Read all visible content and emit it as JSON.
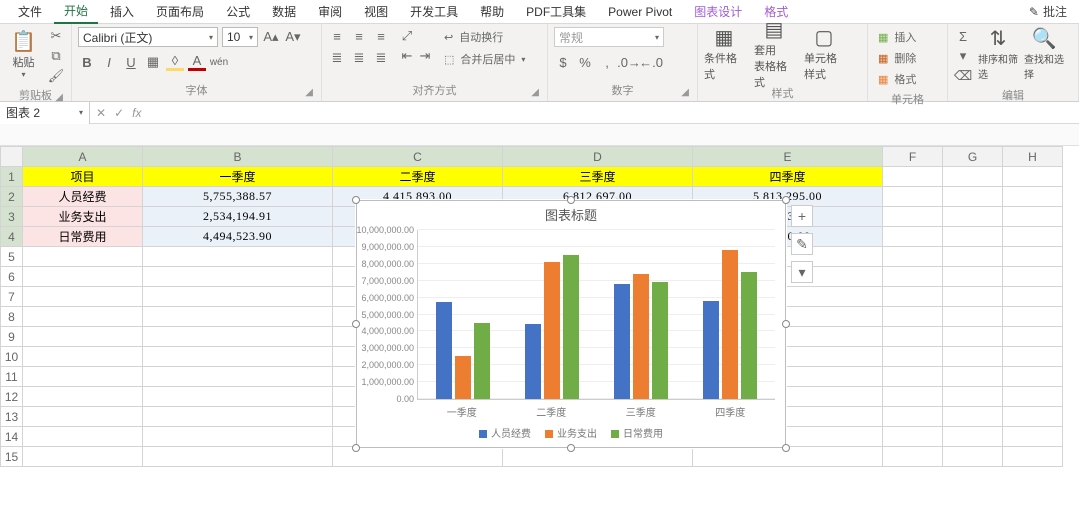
{
  "tabs": {
    "file": "文件",
    "home": "开始",
    "insert": "插入",
    "layout": "页面布局",
    "formulas": "公式",
    "data": "数据",
    "review": "审阅",
    "view": "视图",
    "dev": "开发工具",
    "help": "帮助",
    "pdf": "PDF工具集",
    "pp": "Power Pivot",
    "cdesign": "图表设计",
    "cformat": "格式",
    "comment": "批注"
  },
  "ribbon": {
    "clipboard": {
      "paste": "粘贴",
      "label": "剪贴板"
    },
    "font": {
      "name": "Calibri (正文)",
      "size": "10",
      "label": "字体"
    },
    "alignment": {
      "wrap": "自动换行",
      "merge": "合并后居中",
      "label": "对齐方式"
    },
    "number": {
      "format": "常规",
      "label": "数字"
    },
    "styles": {
      "cond": "条件格式",
      "table": "套用\n表格格式",
      "cell": "单元格样式",
      "label": "样式"
    },
    "cells": {
      "insert": "插入",
      "delete": "删除",
      "format": "格式",
      "label": "单元格"
    },
    "editing": {
      "sort": "排序和筛选",
      "find": "查找和选择",
      "label": "编辑"
    }
  },
  "fxbar": {
    "name": "图表 2",
    "fx": "fx"
  },
  "sheet": {
    "cols": [
      "A",
      "B",
      "C",
      "D",
      "E",
      "F",
      "G",
      "H"
    ],
    "rows": [
      "1",
      "2",
      "3",
      "4",
      "5",
      "6",
      "7",
      "8",
      "9",
      "10",
      "11",
      "12",
      "13",
      "14",
      "15"
    ],
    "headers": [
      "项目",
      "一季度",
      "二季度",
      "三季度",
      "四季度"
    ],
    "rowlabels": [
      "人员经费",
      "业务支出",
      "日常费用"
    ],
    "data": [
      [
        "5,755,388.57",
        "4,415,893.00",
        "6,812,697.00",
        "5,813,295.00"
      ],
      [
        "2,534,194.91",
        "",
        "",
        "6,303.00"
      ],
      [
        "4,494,523.90",
        "",
        "",
        "6,220.00"
      ]
    ]
  },
  "chart": {
    "title": "图表标题",
    "legend": [
      "人员经费",
      "业务支出",
      "日常费用"
    ],
    "xcats": [
      "一季度",
      "二季度",
      "三季度",
      "四季度"
    ],
    "ylim": 10000000,
    "yticks": [
      "0.00",
      "1,000,000.00",
      "2,000,000.00",
      "3,000,000.00",
      "4,000,000.00",
      "5,000,000.00",
      "6,000,000.00",
      "7,000,000.00",
      "8,000,000.00",
      "9,000,000.00",
      "10,000,000.00"
    ]
  },
  "chart_data": {
    "type": "bar",
    "title": "图表标题",
    "categories": [
      "一季度",
      "二季度",
      "三季度",
      "四季度"
    ],
    "series": [
      {
        "name": "人员经费",
        "values": [
          5755388.57,
          4415893.0,
          6812697.0,
          5813295.0
        ]
      },
      {
        "name": "业务支出",
        "values": [
          2534194.91,
          8100000.0,
          7400000.0,
          8800000.0
        ]
      },
      {
        "name": "日常费用",
        "values": [
          4494523.9,
          8500000.0,
          6900000.0,
          7500000.0
        ]
      }
    ],
    "ylim": [
      0,
      10000000
    ],
    "ylabel": "",
    "xlabel": ""
  }
}
